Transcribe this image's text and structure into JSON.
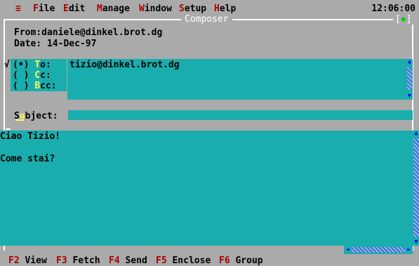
{
  "menubar": {
    "items": [
      {
        "hotkey": "≡",
        "label": ""
      },
      {
        "hotkey": "F",
        "label": "ile"
      },
      {
        "hotkey": "E",
        "label": "dit"
      },
      {
        "hotkey": "M",
        "label": "anage"
      },
      {
        "hotkey": "W",
        "label": "indow"
      },
      {
        "hotkey": "S",
        "label": "etup"
      },
      {
        "hotkey": "H",
        "label": "elp"
      }
    ],
    "clock": "12:06:00"
  },
  "window": {
    "title": "Composer",
    "close_left": "[",
    "close_symbol": "▪",
    "close_right": "]"
  },
  "header": {
    "from": "From:daniele@dinkel.brot.dg",
    "date": "Date: 14-Dec-97"
  },
  "recipients": {
    "check": "√",
    "options": [
      {
        "mark": "(•)",
        "key": "T",
        "rest": "o:",
        "selected": true
      },
      {
        "mark": "( )",
        "key": "C",
        "rest": "c:",
        "selected": false
      },
      {
        "mark": "( )",
        "key": "B",
        "rest": "cc:",
        "selected": false
      }
    ],
    "list": [
      "tizio@dinkel.brot.dg"
    ]
  },
  "subject": {
    "label_pre": "S",
    "label_key": "u",
    "label_post": "bject:",
    "value": ""
  },
  "body": {
    "lines": [
      "Ciao Tizio!",
      "",
      "Come stai?"
    ]
  },
  "scroll_icons": {
    "up": "▲",
    "down": "▼",
    "left": "◄",
    "right": "►"
  },
  "fkeys": [
    {
      "key": "F2",
      "label": "View"
    },
    {
      "key": "F3",
      "label": "Fetch"
    },
    {
      "key": "F4",
      "label": "Send"
    },
    {
      "key": "F5",
      "label": "Enclose"
    },
    {
      "key": "F6",
      "label": "Group"
    }
  ],
  "colors": {
    "field": "#1aadad",
    "chrome": "#aaaaaa",
    "hotkey": "#aa0000",
    "accent": "#ffff55"
  }
}
